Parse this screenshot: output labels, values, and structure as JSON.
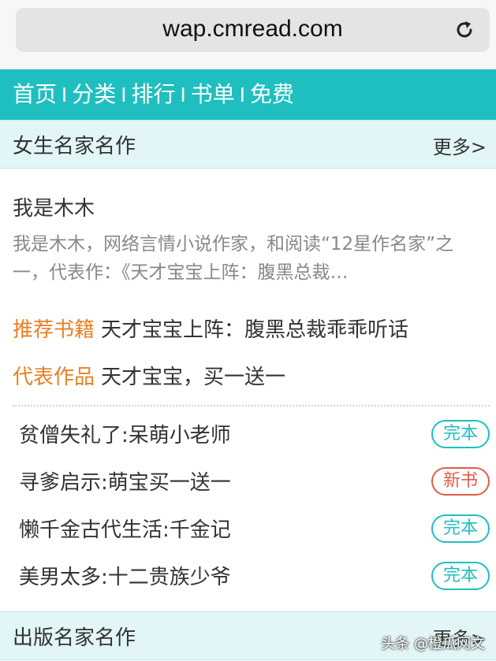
{
  "browser": {
    "url": "wap.cmread.com",
    "reload_icon": "reload-icon"
  },
  "nav": {
    "items": [
      {
        "label": "首页"
      },
      {
        "label": "分类"
      },
      {
        "label": "排行"
      },
      {
        "label": "书单"
      },
      {
        "label": "免费"
      }
    ],
    "separator": "I"
  },
  "section1": {
    "title": "女生名家名作",
    "more": "更多>"
  },
  "author": {
    "name": "我是木木",
    "desc": "我是木木，网络言情小说作家，和阅读“12星作名家”之一，代表作：《天才宝宝上阵：腹黑总裁…",
    "recommend_label": "推荐书籍",
    "recommend_value": "天才宝宝上阵：腹黑总裁乖乖听话",
    "works_label": "代表作品",
    "works_value": "天才宝宝，买一送一"
  },
  "books": [
    {
      "title": "贫僧失礼了:呆萌小老师",
      "badge": "完本",
      "badge_type": "done"
    },
    {
      "title": "寻爹启示:萌宝买一送一",
      "badge": "新书",
      "badge_type": "new"
    },
    {
      "title": "懒千金古代生活:千金记",
      "badge": "完本",
      "badge_type": "done"
    },
    {
      "title": "美男太多:十二贵族少爷",
      "badge": "完本",
      "badge_type": "done"
    }
  ],
  "section2": {
    "title": "出版名家名作",
    "more": "更多>"
  },
  "watermark": "头条 @橙瓜网文",
  "colors": {
    "accent": "#1fbfc0",
    "section_bg": "#e2f6f7",
    "label_orange": "#ea7f22",
    "new_red": "#e45b4a"
  }
}
